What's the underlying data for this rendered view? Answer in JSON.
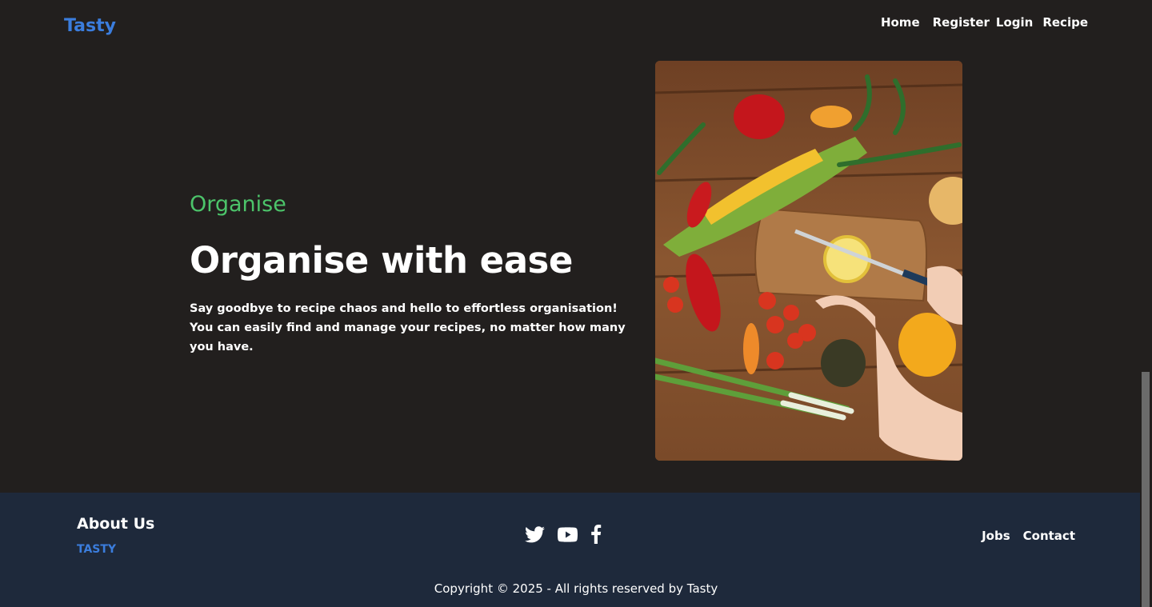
{
  "header": {
    "brand": "Tasty",
    "nav": {
      "home": "Home",
      "register": "Register",
      "login": "Login",
      "recipe": "Recipe"
    }
  },
  "hero": {
    "eyebrow": "Organise",
    "headline": "Organise with ease",
    "description_line1": "Say goodbye to recipe chaos and hello to effortless organisation!",
    "description_line2": "You can easily find and manage your recipes, no matter how many you have.",
    "image_alt": "Vegetables on a wooden table with hands slicing a lemon"
  },
  "footer": {
    "about_title": "About Us",
    "about_brand": "TASTY",
    "socials": [
      "twitter-icon",
      "youtube-icon",
      "facebook-icon"
    ],
    "links": {
      "jobs": "Jobs",
      "contact": "Contact"
    },
    "copyright": "Copyright © 2025 - All rights reserved by Tasty"
  },
  "colors": {
    "background": "#221f1e",
    "footer_bg": "#1e293b",
    "brand_blue": "#3b7ddd",
    "accent_green": "#4cc46a"
  }
}
